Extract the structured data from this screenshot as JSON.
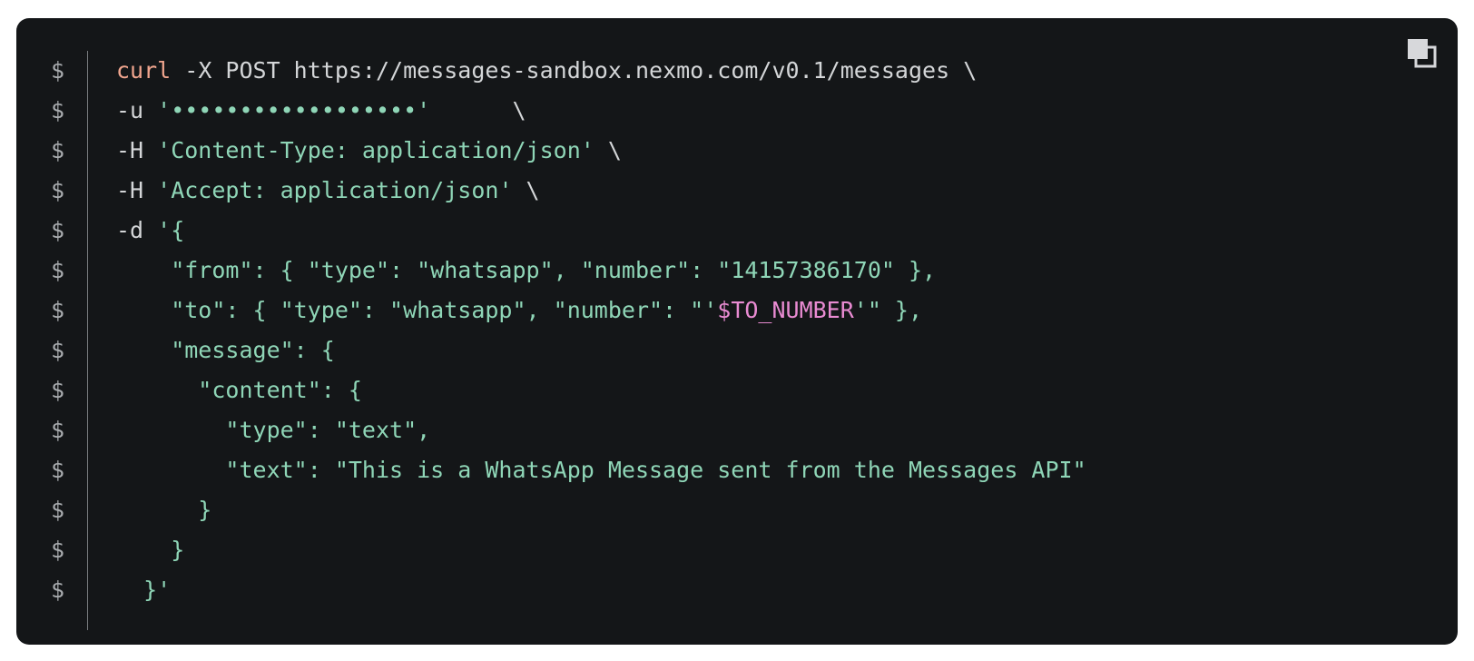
{
  "prompt_symbol": "$",
  "copy_icon": "copy-icon",
  "colors": {
    "background": "#141618",
    "command": "#f0a58e",
    "plain": "#d4d6d8",
    "string": "#8fd6b7",
    "variable": "#e98bd2",
    "prompt": "#a9acaf"
  },
  "lines": [
    [
      {
        "t": "cmd",
        "v": "curl"
      },
      {
        "t": "plain",
        "v": " -X POST https://messages-sandbox.nexmo.com/v0.1/messages \\"
      }
    ],
    [
      {
        "t": "plain",
        "v": "-u "
      },
      {
        "t": "str",
        "v": "'••••••••••••••••••'"
      },
      {
        "t": "plain",
        "v": "      \\"
      }
    ],
    [
      {
        "t": "plain",
        "v": "-H "
      },
      {
        "t": "str",
        "v": "'Content-Type: application/json'"
      },
      {
        "t": "plain",
        "v": " \\"
      }
    ],
    [
      {
        "t": "plain",
        "v": "-H "
      },
      {
        "t": "str",
        "v": "'Accept: application/json'"
      },
      {
        "t": "plain",
        "v": " \\"
      }
    ],
    [
      {
        "t": "plain",
        "v": "-d "
      },
      {
        "t": "str",
        "v": "'{"
      }
    ],
    [
      {
        "t": "str",
        "v": "    \"from\": { \"type\": \"whatsapp\", \"number\": \"14157386170\" },"
      }
    ],
    [
      {
        "t": "str",
        "v": "    \"to\": { \"type\": \"whatsapp\", \"number\": \"'"
      },
      {
        "t": "var",
        "v": "$TO_NUMBER"
      },
      {
        "t": "str",
        "v": "'\" },"
      }
    ],
    [
      {
        "t": "str",
        "v": "    \"message\": {"
      }
    ],
    [
      {
        "t": "str",
        "v": "      \"content\": {"
      }
    ],
    [
      {
        "t": "str",
        "v": "        \"type\": \"text\","
      }
    ],
    [
      {
        "t": "str",
        "v": "        \"text\": \"This is a WhatsApp Message sent from the Messages API\""
      }
    ],
    [
      {
        "t": "str",
        "v": "      }"
      }
    ],
    [
      {
        "t": "str",
        "v": "    }"
      }
    ],
    [
      {
        "t": "str",
        "v": "  }'"
      }
    ]
  ]
}
